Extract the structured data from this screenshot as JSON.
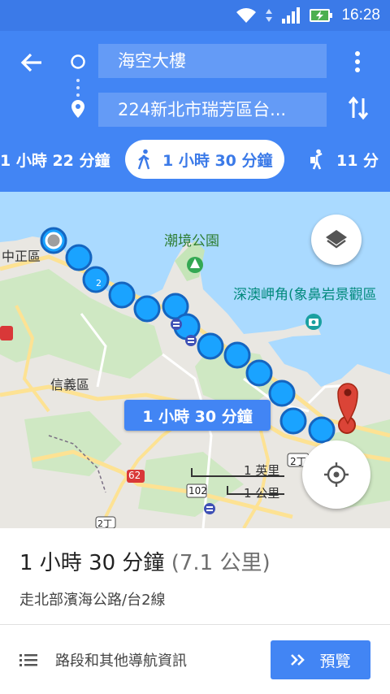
{
  "status_bar": {
    "time": "16:28"
  },
  "search": {
    "origin": "海空大樓",
    "destination": "224新北市瑞芳區台..."
  },
  "modes": [
    {
      "name": "driving",
      "label": "1 小時 22 分鐘",
      "active": false
    },
    {
      "name": "walking",
      "label": "1 小時 30 分鐘",
      "active": true
    },
    {
      "name": "ride-hailing",
      "label": "11 分",
      "active": false
    }
  ],
  "map": {
    "route_badge": "1 小時 30 分鐘",
    "labels": {
      "zhongzheng": "中正區",
      "xinyi": "信義區",
      "park": "潮境公園",
      "cape": "深澳岬角(象鼻岩景觀區",
      "shield_2": "2",
      "shield_62": "62",
      "shield_102": "102",
      "shield_2d": "2丁",
      "shield_2d_b": "2丁"
    },
    "scale": {
      "imperial": "1 英里",
      "metric": "1 公里"
    }
  },
  "summary": {
    "duration": "1 小時 30 分鐘",
    "distance": "(7.1 公里)",
    "via": "走北部濱海公路/台2線"
  },
  "actions": {
    "steps_label": "路段和其他導航資訊",
    "preview_label": "預覽"
  },
  "colors": {
    "header": "#4285f4",
    "statusbar": "#3b7ae8",
    "route_dot": "#1aa3ff",
    "pin": "#db4437"
  }
}
